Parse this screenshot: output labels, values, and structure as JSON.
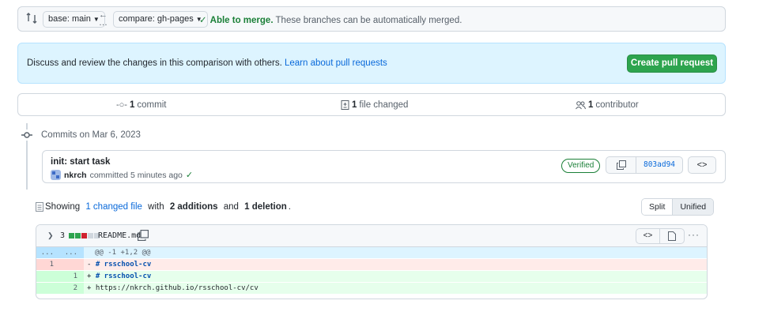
{
  "compare_bar": {
    "base_label": "base: main",
    "compare_label": "compare: gh-pages",
    "merge_ok": "Able to merge.",
    "merge_rest": "These branches can be automatically merged."
  },
  "banner": {
    "text": "Discuss and review the changes in this comparison with others.",
    "link": "Learn about pull requests",
    "button": "Create pull request"
  },
  "stats": {
    "commits_count": "1",
    "commits_label": "commit",
    "files_count": "1",
    "files_label": "file changed",
    "contributors_count": "1",
    "contributors_label": "contributor"
  },
  "timeline": {
    "heading": "Commits on Mar 6, 2023"
  },
  "commit": {
    "title": "init: start task",
    "author": "nkrch",
    "meta": "committed 5 minutes ago",
    "verified": "Verified",
    "sha": "803ad94"
  },
  "showing": {
    "prefix": "Showing",
    "files_link": "1 changed file",
    "with": "with",
    "additions": "2 additions",
    "and": "and",
    "deletions": "1 deletion",
    "end": "."
  },
  "view_toggle": {
    "split": "Split",
    "unified": "Unified"
  },
  "file": {
    "change_count": "3",
    "name": "README.md",
    "diffstat_colors": [
      "#2da44e",
      "#2da44e",
      "#cf222e",
      "#d0d7de",
      "#d0d7de"
    ],
    "rows": [
      {
        "type": "hunk",
        "old": "...",
        "new": "...",
        "code": "@@ -1 +1,2 @@"
      },
      {
        "type": "del",
        "old": "1",
        "new": "",
        "sign": "-",
        "code": "# rsschool-cv"
      },
      {
        "type": "add",
        "old": "",
        "new": "1",
        "sign": "+",
        "code": "# rsschool-cv"
      },
      {
        "type": "add",
        "old": "",
        "new": "2",
        "sign": "+",
        "code": "https://nkrch.github.io/rsschool-cv/cv"
      }
    ]
  }
}
